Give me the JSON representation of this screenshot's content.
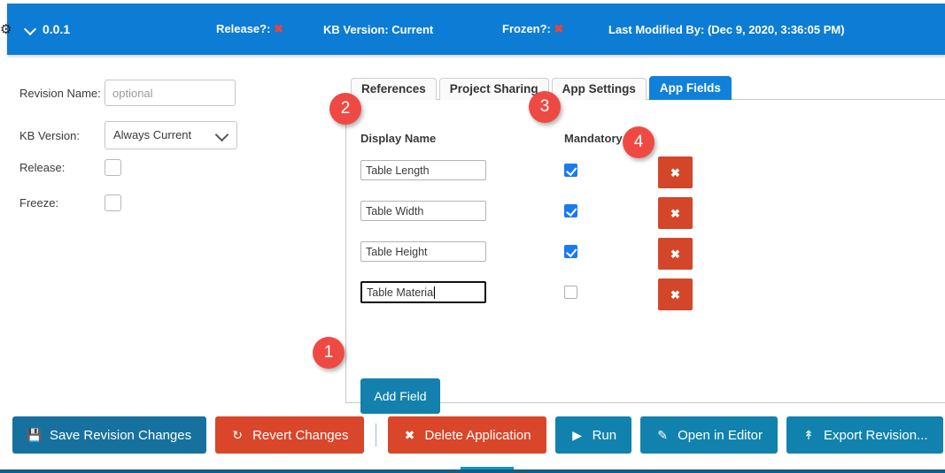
{
  "header": {
    "version": "0.0.1",
    "chevron_icon": "chevron-down-icon",
    "release_label": "Release?:",
    "release_value": "✖",
    "kb_version": "KB Version: Current",
    "frozen_label": "Frozen?:",
    "frozen_value": "✖",
    "last_modified": "Last Modified By:  (Dec 9, 2020, 3:36:05 PM)",
    "bar_color": "#0d7cd4",
    "x_color": "#e8453c"
  },
  "left_form": {
    "revision_name_label": "Revision Name:",
    "revision_name_value": "",
    "revision_name_placeholder": "optional",
    "kb_version_label": "KB Version:",
    "kb_version_selected": "Always Current",
    "release_label": "Release:",
    "release_checked": false,
    "freeze_label": "Freeze:",
    "freeze_checked": false
  },
  "tabs": [
    {
      "label": "References",
      "active": false
    },
    {
      "label": "Project Sharing",
      "active": false
    },
    {
      "label": "App Settings",
      "active": false
    },
    {
      "label": "App Fields",
      "active": true
    }
  ],
  "app_fields": {
    "col_display_name": "Display Name",
    "col_mandatory": "Mandatory",
    "delete_icon": "close-x-icon",
    "rows": [
      {
        "display_name": "Table Length",
        "mandatory": true,
        "focused": false
      },
      {
        "display_name": "Table Width",
        "mandatory": true,
        "focused": false
      },
      {
        "display_name": "Table Height",
        "mandatory": true,
        "focused": false
      },
      {
        "display_name": "Table Material",
        "mandatory": false,
        "focused": true
      }
    ],
    "add_field_label": "Add Field",
    "add_field_color": "#1380ad",
    "delete_btn_color": "#d4462a",
    "checkbox_color": "#1a7af0"
  },
  "bottom_toolbar": {
    "save_icon": "floppy-disk-icon",
    "save_label": "Save Revision Changes",
    "revert_icon": "undo-arrow-icon",
    "revert_label": "Revert Changes",
    "delete_icon": "close-x-icon",
    "delete_label": "Delete Application",
    "run_icon": "play-triangle-icon",
    "run_label": "Run",
    "editor_icon": "pencil-icon",
    "editor_label": "Open in Editor",
    "export_icon": "upload-icon",
    "export_label": "Export Revision...",
    "blue_color": "#17719e",
    "red_color": "#d9462a",
    "teal_color": "#1182ad"
  },
  "annotations": {
    "badge_1": "1",
    "badge_2": "2",
    "badge_3": "3",
    "badge_4": "4",
    "badge_color": "#ee4a43"
  }
}
